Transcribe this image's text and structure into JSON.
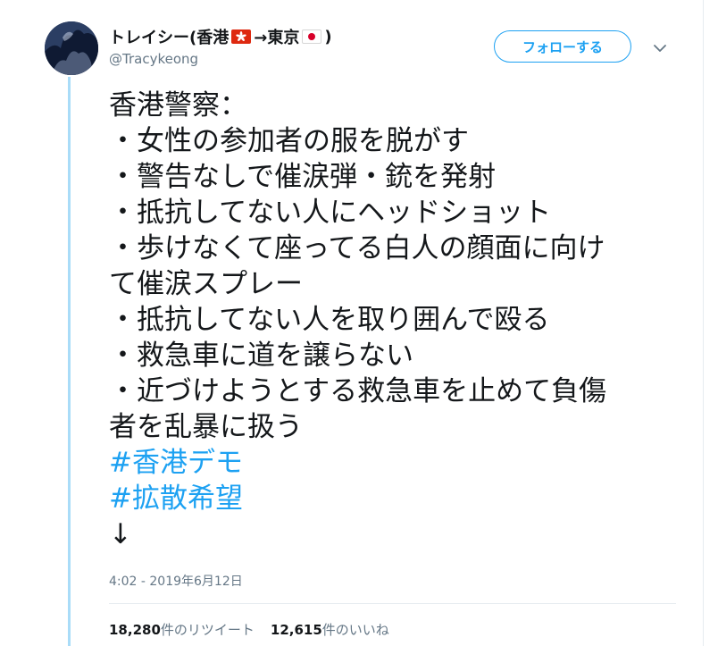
{
  "colors": {
    "accent": "#1da1f2",
    "text_primary": "#14171a",
    "text_secondary": "#657786",
    "thread_line": "#a9dcf8"
  },
  "author": {
    "name_prefix": "トレイシー(香港",
    "name_flag_1": "hong-kong-flag-icon",
    "name_arrow": "→東京",
    "name_flag_2": "japan-flag-icon",
    "name_suffix": ")",
    "handle": "@Tracykeong",
    "avatar_icon": "avatar"
  },
  "follow_button": {
    "label": "フォローする"
  },
  "menu_caret_icon": "chevron-down-icon",
  "tweet": {
    "lines": [
      "香港警察：",
      "・女性の参加者の服を脱がす",
      "・警告なしで催涙弾・銃を発射",
      "・抵抗してない人にヘッドショット",
      "・歩けなくて座ってる白人の顔面に向け",
      "て催涙スプレー",
      "・抵抗してない人を取り囲んで殴る",
      "・救急車に道を譲らない",
      "・近づけようとする救急車を止めて負傷",
      "者を乱暴に扱う"
    ],
    "hashtags": [
      "#香港デモ",
      "#拡散希望"
    ],
    "trailing": "↓"
  },
  "timestamp": "4:02 - 2019年6月12日",
  "stats": {
    "retweets_count": "18,280",
    "retweets_label": "件のリツイート",
    "likes_count": "12,615",
    "likes_label": "件のいいね"
  }
}
